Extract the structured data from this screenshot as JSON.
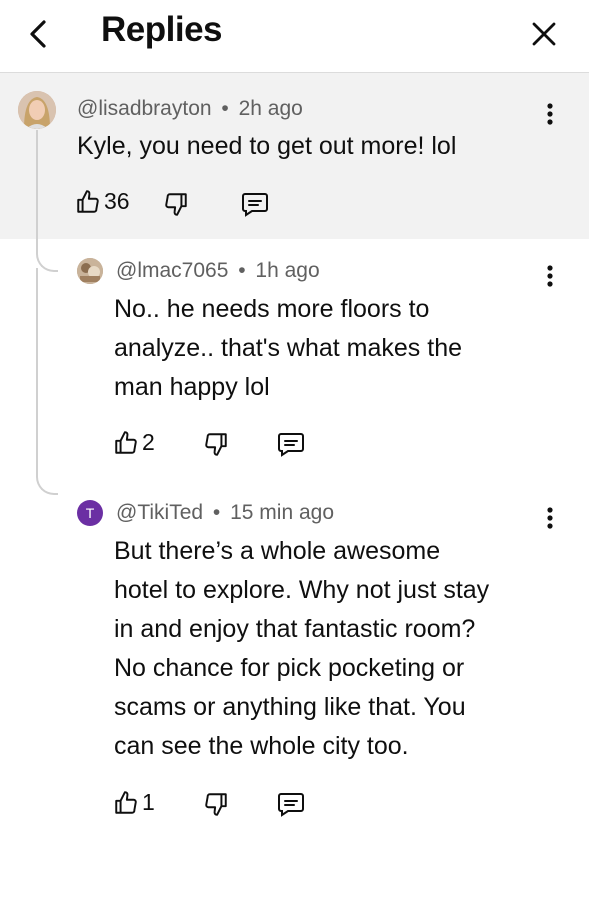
{
  "header": {
    "title": "Replies",
    "back_icon": "chevron-left-icon",
    "close_icon": "close-icon"
  },
  "comments": [
    {
      "handle": "@lisadbrayton",
      "time": "2h ago",
      "text": "Kyle, you need to get out more! lol",
      "likes": "36"
    },
    {
      "handle": "@lmac7065",
      "time": "1h ago",
      "text_lines": [
        "No.. he needs more floors to",
        "analyze.. that's what makes the",
        "man happy lol"
      ],
      "likes": "2"
    },
    {
      "handle": "@TikiTed",
      "time": "15 min ago",
      "avatar_letter": "T",
      "avatar_color": "#6b2fa3",
      "text_lines": [
        "But there’s a whole awesome",
        "hotel to explore. Why not just stay",
        "in and enjoy that fantastic room?",
        "No chance for pick pocketing or",
        "scams or anything like that. You",
        "can see the whole city too."
      ],
      "likes": "1"
    }
  ],
  "separator": "•"
}
